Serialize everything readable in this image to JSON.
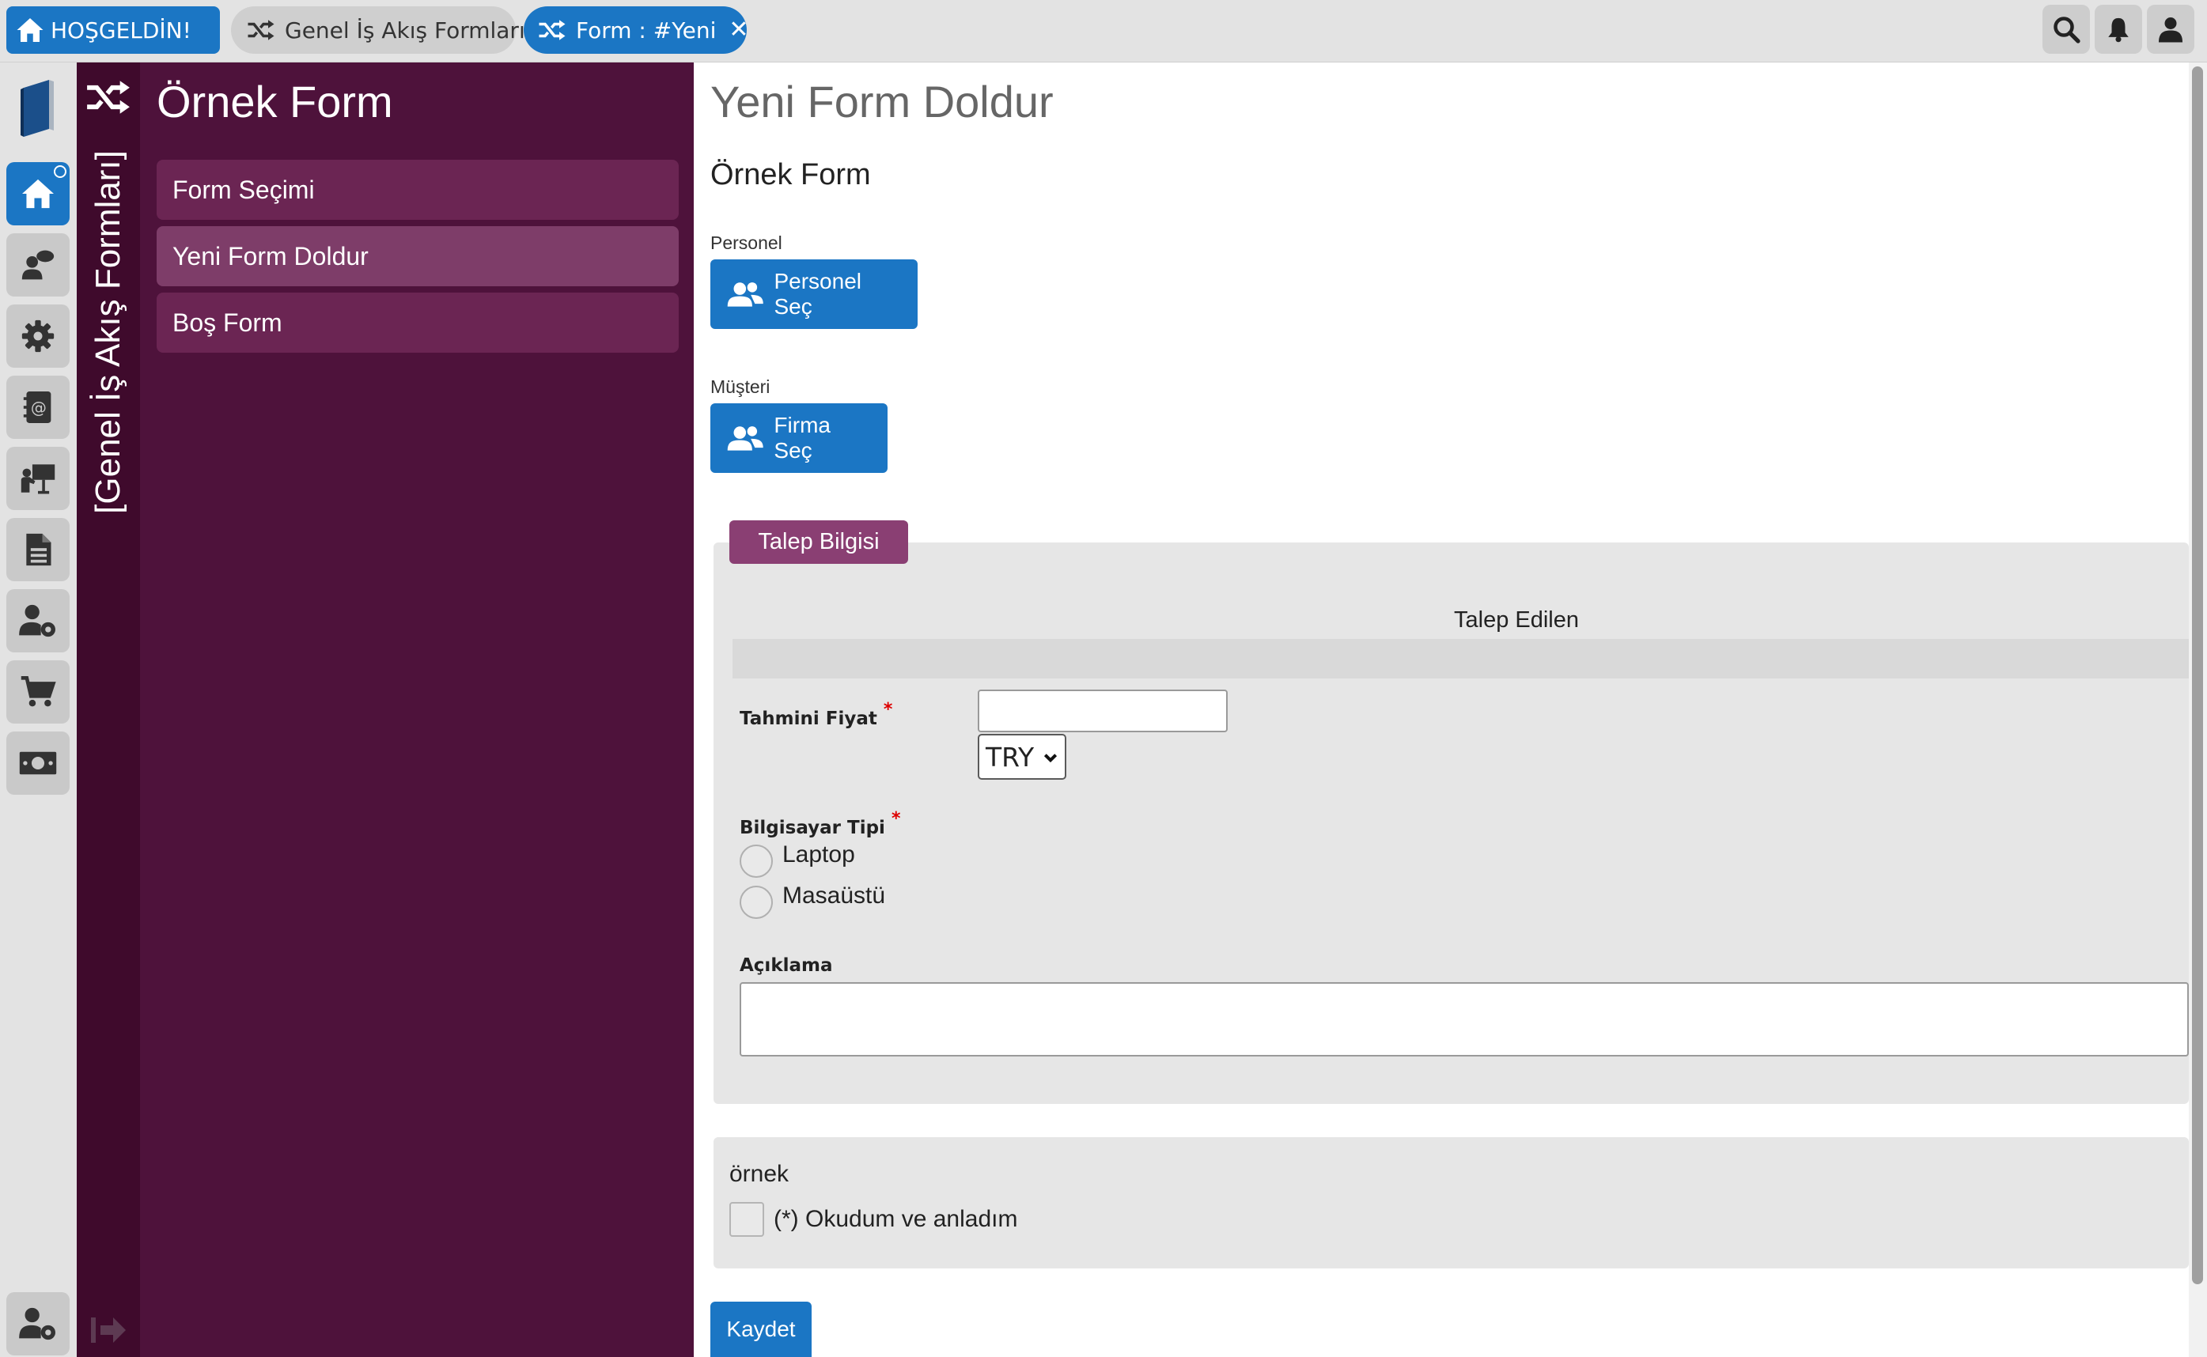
{
  "topbar": {
    "tabs": [
      {
        "label": "HOŞGELDİN!",
        "icon": "home-icon",
        "active": true
      },
      {
        "label": "Genel İş Akış Formları",
        "icon": "shuffle-icon",
        "active": false
      },
      {
        "label": "Form : #Yeni",
        "icon": "shuffle-icon",
        "active": true,
        "closable": true
      }
    ],
    "close_glyph": "✕",
    "right_icons": [
      "search-icon",
      "bell-icon",
      "user-icon"
    ]
  },
  "rail": {
    "items": [
      "book-logo-icon",
      "home-icon",
      "user-chat-icon",
      "gear-icon",
      "address-book-icon",
      "presentation-icon",
      "document-icon",
      "user-settings-icon",
      "cart-icon",
      "money-icon"
    ],
    "bottom": [
      "user-settings-icon",
      "logout-icon"
    ]
  },
  "sidebar": {
    "vertical_title": "[Genel İş Akış Formları]",
    "title": "Örnek Form",
    "items": [
      {
        "label": "Form Seçimi",
        "active": false
      },
      {
        "label": "Yeni Form Doldur",
        "active": true
      },
      {
        "label": "Boş Form",
        "active": false
      }
    ]
  },
  "main": {
    "page_title": "Yeni Form Doldur",
    "form_name": "Örnek Form",
    "personel_label": "Personel",
    "personel_button": "Personel Seç",
    "musteri_label": "Müşteri",
    "musteri_button": "Firma Seç",
    "fieldset_legend": "Talep Bilgisi",
    "section_title": "Talep Edilen",
    "fields": {
      "price_label": "Tahmini Fiyat",
      "price_value": "",
      "currency_selected": "TRY",
      "computer_type_label": "Bilgisayar Tipi",
      "radio_options": [
        "Laptop",
        "Masaüstü"
      ],
      "description_label": "Açıklama",
      "description_value": "",
      "required_mark": "*"
    },
    "agreement": {
      "title": "örnek",
      "checkbox_label": "(*) Okudum ve anladım",
      "checked": false
    },
    "save_button": "Kaydet"
  },
  "colors": {
    "accent": "#1b76c4",
    "sidebar_dark": "#3f0a2c",
    "sidebar": "#4e123b",
    "sidebar_item": "#6b2553",
    "sidebar_item_active": "#7e3d69",
    "legend": "#8a3f73"
  }
}
